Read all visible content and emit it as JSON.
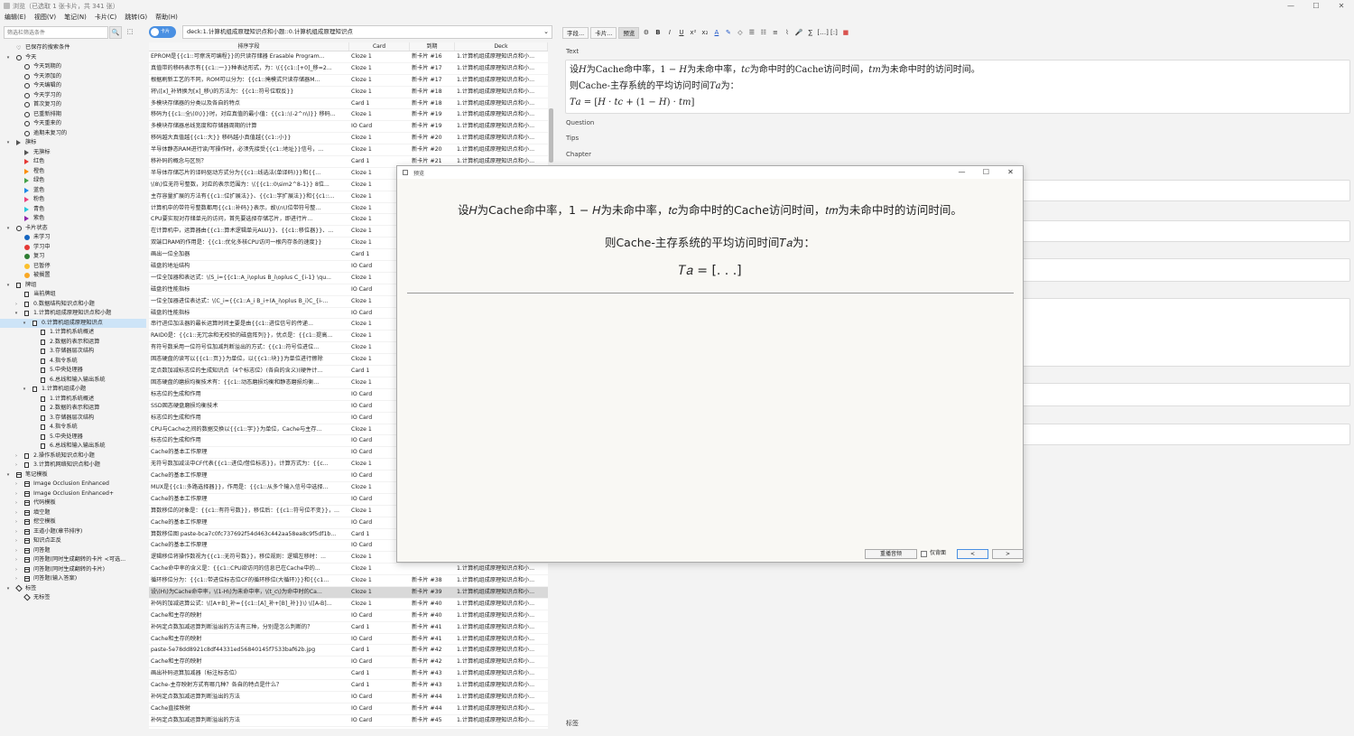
{
  "window": {
    "title": "浏览（已选取 1 张卡片，共 341 张）",
    "controls": [
      "—",
      "☐",
      "✕"
    ]
  },
  "menu": [
    "编辑(E)",
    "视图(V)",
    "笔记(N)",
    "卡片(C)",
    "跳转(G)",
    "帮助(H)"
  ],
  "sidebar": {
    "search_placeholder": "筛选栏筛选条件",
    "search_btn": "🔍",
    "toggle_btn": "⬚",
    "items": [
      {
        "label": "已保存的搜索条件",
        "level": 0,
        "icon": "heart",
        "arrow": ""
      },
      {
        "label": "今天",
        "level": 0,
        "icon": "clock",
        "arrow": "▾"
      },
      {
        "label": "今天到期的",
        "level": 1,
        "icon": "clock",
        "arrow": ""
      },
      {
        "label": "今天添加的",
        "level": 1,
        "icon": "clock",
        "arrow": ""
      },
      {
        "label": "今天编辑的",
        "level": 1,
        "icon": "clock",
        "arrow": ""
      },
      {
        "label": "今天学习的",
        "level": 1,
        "icon": "clock",
        "arrow": ""
      },
      {
        "label": "首次复习的",
        "level": 1,
        "icon": "clock",
        "arrow": ""
      },
      {
        "label": "已重新排期",
        "level": 1,
        "icon": "clock",
        "arrow": ""
      },
      {
        "label": "今天重来的",
        "level": 1,
        "icon": "clock",
        "arrow": ""
      },
      {
        "label": "逾期未复习的",
        "level": 1,
        "icon": "clock",
        "arrow": ""
      },
      {
        "label": "旗标",
        "level": 0,
        "icon": "flag",
        "arrow": "▾"
      },
      {
        "label": "无旗标",
        "level": 1,
        "icon": "flag",
        "arrow": ""
      },
      {
        "label": "红色",
        "level": 1,
        "icon": "flag",
        "arrow": "",
        "color": "#e53935"
      },
      {
        "label": "橙色",
        "level": 1,
        "icon": "flag",
        "arrow": "",
        "color": "#fb8c00"
      },
      {
        "label": "绿色",
        "level": 1,
        "icon": "flag",
        "arrow": "",
        "color": "#43a047"
      },
      {
        "label": "蓝色",
        "level": 1,
        "icon": "flag",
        "arrow": "",
        "color": "#1e88e5"
      },
      {
        "label": "粉色",
        "level": 1,
        "icon": "flag",
        "arrow": "",
        "color": "#ec407a"
      },
      {
        "label": "青色",
        "level": 1,
        "icon": "flag",
        "arrow": "",
        "color": "#26c6da"
      },
      {
        "label": "紫色",
        "level": 1,
        "icon": "flag",
        "arrow": "",
        "color": "#8e24aa"
      },
      {
        "label": "卡片状态",
        "level": 0,
        "icon": "circle",
        "arrow": "▾"
      },
      {
        "label": "未学习",
        "level": 1,
        "icon": "dot",
        "arrow": "",
        "color": "#1565c0"
      },
      {
        "label": "学习中",
        "level": 1,
        "icon": "dot",
        "arrow": "",
        "color": "#e53935"
      },
      {
        "label": "复习",
        "level": 1,
        "icon": "dot",
        "arrow": "",
        "color": "#2e7d32"
      },
      {
        "label": "已暂停",
        "level": 1,
        "icon": "dot",
        "arrow": "",
        "color": "#fbc02d"
      },
      {
        "label": "被搁置",
        "level": 1,
        "icon": "dot",
        "arrow": "",
        "color": "#f9a825"
      },
      {
        "label": "牌组",
        "level": 0,
        "icon": "deck",
        "arrow": "▾"
      },
      {
        "label": "当前牌组",
        "level": 1,
        "icon": "deck",
        "arrow": ""
      },
      {
        "label": "0.数据结构知识点和小题",
        "level": 1,
        "icon": "deck",
        "arrow": "›"
      },
      {
        "label": "1.计算机组成原理知识点和小题",
        "level": 1,
        "icon": "deck",
        "arrow": "▾"
      },
      {
        "label": "0.计算机组成原理知识点",
        "level": 2,
        "icon": "deck",
        "arrow": "▾",
        "selected": true
      },
      {
        "label": "1.计算机系统概述",
        "level": 3,
        "icon": "deck",
        "arrow": ""
      },
      {
        "label": "2.数据的表示和运算",
        "level": 3,
        "icon": "deck",
        "arrow": ""
      },
      {
        "label": "3.存储器层次结构",
        "level": 3,
        "icon": "deck",
        "arrow": ""
      },
      {
        "label": "4.指令系统",
        "level": 3,
        "icon": "deck",
        "arrow": ""
      },
      {
        "label": "5.中央处理器",
        "level": 3,
        "icon": "deck",
        "arrow": ""
      },
      {
        "label": "6.总线和输入输出系统",
        "level": 3,
        "icon": "deck",
        "arrow": ""
      },
      {
        "label": "1.计算机组成小题",
        "level": 2,
        "icon": "deck",
        "arrow": "▾"
      },
      {
        "label": "1.计算机系统概述",
        "level": 3,
        "icon": "deck",
        "arrow": ""
      },
      {
        "label": "2.数据的表示和运算",
        "level": 3,
        "icon": "deck",
        "arrow": ""
      },
      {
        "label": "3.存储器层次结构",
        "level": 3,
        "icon": "deck",
        "arrow": ""
      },
      {
        "label": "4.指令系统",
        "level": 3,
        "icon": "deck",
        "arrow": ""
      },
      {
        "label": "5.中央处理器",
        "level": 3,
        "icon": "deck",
        "arrow": ""
      },
      {
        "label": "6.总线和输入输出系统",
        "level": 3,
        "icon": "deck",
        "arrow": ""
      },
      {
        "label": "2.操作系统知识点和小题",
        "level": 1,
        "icon": "deck",
        "arrow": "›"
      },
      {
        "label": "3.计算机网络知识点和小题",
        "level": 1,
        "icon": "deck",
        "arrow": "›"
      },
      {
        "label": "笔记模板",
        "level": 0,
        "icon": "grid",
        "arrow": "▾"
      },
      {
        "label": "Image Occlusion Enhanced",
        "level": 1,
        "icon": "grid",
        "arrow": "›"
      },
      {
        "label": "Image Occlusion Enhanced+",
        "level": 1,
        "icon": "grid",
        "arrow": "›"
      },
      {
        "label": "代码模板",
        "level": 1,
        "icon": "grid",
        "arrow": "›"
      },
      {
        "label": "填空题",
        "level": 1,
        "icon": "grid",
        "arrow": "›"
      },
      {
        "label": "挖空模板",
        "level": 1,
        "icon": "grid",
        "arrow": "›"
      },
      {
        "label": "王道小题(章节排序)",
        "level": 1,
        "icon": "grid",
        "arrow": "›"
      },
      {
        "label": "知识点正反",
        "level": 1,
        "icon": "grid",
        "arrow": "›"
      },
      {
        "label": "问答题",
        "level": 1,
        "icon": "grid",
        "arrow": "›"
      },
      {
        "label": "问答题(同时生成翻转的卡片 <可选...",
        "level": 1,
        "icon": "grid",
        "arrow": "›"
      },
      {
        "label": "问答题(同时生成翻转的卡片)",
        "level": 1,
        "icon": "grid",
        "arrow": "›"
      },
      {
        "label": "问答题(输入答案)",
        "level": 1,
        "icon": "grid",
        "arrow": "›"
      },
      {
        "label": "标签",
        "level": 0,
        "icon": "tag",
        "arrow": "▾"
      },
      {
        "label": "无标签",
        "level": 1,
        "icon": "tag",
        "arrow": ""
      }
    ]
  },
  "toolbar": {
    "toggle_label": "卡片",
    "deck_query": "deck:1.计算机组成原理知识点和小题::0.计算机组成原理知识点"
  },
  "table": {
    "headers": [
      "排序字段",
      "Card",
      "到期",
      "Deck"
    ],
    "rows": [
      [
        "EPROM是{{c1::可擦洗可编程}}的只读存储器 Erasable Program...",
        "Cloze 1",
        "新卡片 #16",
        "1.计算机组成原理知识点和小..."
      ],
      [
        "真值带的移码表示有{{c1::一}}种表达形式，为：\\({{c1::[+0]_移=2...",
        "Cloze 1",
        "新卡片 #17",
        "1.计算机组成原理知识点和小..."
      ],
      [
        "根据刷新工艺的不同，ROM可以分为：{{c1::掩模式只读存储器M...",
        "Cloze 1",
        "新卡片 #17",
        "1.计算机组成原理知识点和小..."
      ],
      [
        "将\\([x]_补转换为[x]_移\\)的方法为：{{c1::符号位取反}}",
        "Cloze 1",
        "新卡片 #18",
        "1.计算机组成原理知识点和小..."
      ],
      [
        "多模块存储器的分类以及各自的特点",
        "Card 1",
        "新卡片 #18",
        "1.计算机组成原理知识点和小..."
      ],
      [
        "移码为{{c1::全\\(0\\)}}时，对应真值的最小值：{{c1::\\(-2^n\\)}} 移码...",
        "Cloze 1",
        "新卡片 #19",
        "1.计算机组成原理知识点和小..."
      ],
      [
        "多模块存储器总线宽度和存储器周期的计算",
        "IO Card",
        "新卡片 #19",
        "1.计算机组成原理知识点和小..."
      ],
      [
        "移码越大真值越{{c1::大}} 移码越小真值越{{c1::小}}",
        "Cloze 1",
        "新卡片 #20",
        "1.计算机组成原理知识点和小..."
      ],
      [
        "半导体静态RAM进行读/写操作时，必须先接受{{c1::地址}}信号，...",
        "Cloze 1",
        "新卡片 #20",
        "1.计算机组成原理知识点和小..."
      ],
      [
        "移补码的概念与区别？",
        "Card 1",
        "新卡片 #21",
        "1.计算机组成原理知识点和小..."
      ],
      [
        "半导体存储芯片的译码驱动方式分为{{c1::线选法(单译码)}}和{{...",
        "Cloze 1",
        "",
        "1.计算机组成原理知识点和小..."
      ],
      [
        "\\(8\\)位无符号整数，对应的表示范围为：\\({{c1::0\\sim2^8-1}} 8位...",
        "Cloze 1",
        "",
        "1.计算机组成原理知识点和小..."
      ],
      [
        "主存容量扩展的方法有{{c1::位扩展法}}、{{c1::字扩展法}}和{{c1::...",
        "Cloze 1",
        "",
        "1.计算机组成原理知识点和小..."
      ],
      [
        "计算机中的带符号整数都用{{c1::补码}}表示，故\\(n\\)位带符号整...",
        "Cloze 1",
        "",
        "1.计算机组成原理知识点和小..."
      ],
      [
        "CPU要实现对存储单元的访问，首先要选择存储芯片，即进行片...",
        "Cloze 1",
        "",
        "1.计算机组成原理知识点和小..."
      ],
      [
        "在计算机中，运算器由{{c1::算术逻辑单元ALU}}、{{c1::移位器}}、...",
        "Cloze 1",
        "",
        "1.计算机组成原理知识点和小..."
      ],
      [
        "双端口RAM的作用是：{{c1::优化多核CPU访问一根内存条的速度}}",
        "Cloze 1",
        "",
        "1.计算机组成原理知识点和小..."
      ],
      [
        "画出一位全加器",
        "Card 1",
        "",
        "1.计算机组成原理知识点和小..."
      ],
      [
        "磁盘的地址结构",
        "IO Card",
        "",
        "1.计算机组成原理知识点和小..."
      ],
      [
        "一位全加器和表达式：\\(S_i={{c1::A_i\\oplus B_i\\oplus C_{i-1} \\qu...",
        "Cloze 1",
        "",
        "1.计算机组成原理知识点和小..."
      ],
      [
        "磁盘的性能指标",
        "IO Card",
        "",
        "1.计算机组成原理知识点和小..."
      ],
      [
        "一位全加器进位表达式：\\(C_i={{c1::A_i B_i+(A_i\\oplus B_i)C_{i-...",
        "Cloze 1",
        "",
        "1.计算机组成原理知识点和小..."
      ],
      [
        "磁盘的性能指标",
        "IO Card",
        "",
        "1.计算机组成原理知识点和小..."
      ],
      [
        "串行进位加法器的最长运算时间主要是由{{c1::进位信号的传递...",
        "Cloze 1",
        "",
        "1.计算机组成原理知识点和小..."
      ],
      [
        "RAID0是：{{c1::无冗余和无校验的磁盘阵列}}，优点是：{{c1::提高...",
        "Cloze 1",
        "",
        "1.计算机组成原理知识点和小..."
      ],
      [
        "有符号数采用一位符号位加减判断溢出的方式：{{c1::符号位进位...",
        "Cloze 1",
        "",
        "1.计算机组成原理知识点和小..."
      ],
      [
        "固态硬盘的读写以{{c1::页}}为单位，以{{c1::块}}为单位进行擦除",
        "Cloze 1",
        "",
        "1.计算机组成原理知识点和小..."
      ],
      [
        "定点数加减标志位的生成知识点（4个标志位）(各自的含义)(硬件计...",
        "Card 1",
        "",
        "1.计算机组成原理知识点和小..."
      ],
      [
        "固态硬盘的磨损均衡技术有：{{c1::动态磨损均衡和静态磨损均衡...",
        "Cloze 1",
        "",
        "1.计算机组成原理知识点和小..."
      ],
      [
        "标志位的生成和作用",
        "IO Card",
        "",
        "1.计算机组成原理知识点和小..."
      ],
      [
        "SSD固态硬盘磨损均衡技术",
        "IO Card",
        "",
        "1.计算机组成原理知识点和小..."
      ],
      [
        "标志位的生成和作用",
        "IO Card",
        "",
        "1.计算机组成原理知识点和小..."
      ],
      [
        "CPU与Cache之间的数据交换以{{c1::字}}为单位，Cache与主存...",
        "Cloze 1",
        "",
        "1.计算机组成原理知识点和小..."
      ],
      [
        "标志位的生成和作用",
        "IO Card",
        "",
        "1.计算机组成原理知识点和小..."
      ],
      [
        "Cache的基本工作原理",
        "IO Card",
        "",
        "1.计算机组成原理知识点和小..."
      ],
      [
        "无符号数加减法中CF代表{{c1::进位/借位标志}}，计算方式为：{{c...",
        "Cloze 1",
        "",
        "1.计算机组成原理知识点和小..."
      ],
      [
        "Cache的基本工作原理",
        "IO Card",
        "",
        "1.计算机组成原理知识点和小..."
      ],
      [
        "MUX是{{c1::多路选择器}}，作用是：{{c1::从多个输入信号中选择...",
        "Cloze 1",
        "",
        "1.计算机组成原理知识点和小..."
      ],
      [
        "Cache的基本工作原理",
        "IO Card",
        "",
        "1.计算机组成原理知识点和小..."
      ],
      [
        "算数移位的对象是：{{c1::有符号数}}，移位后：{{c1::符号位不变}}，...",
        "Cloze 1",
        "",
        "1.计算机组成原理知识点和小..."
      ],
      [
        "Cache的基本工作原理",
        "IO Card",
        "",
        "1.计算机组成原理知识点和小..."
      ],
      [
        "算数移位图 paste-bca7c0fc737692f54d463c442aa58ea8c9f5df1b...",
        "Card 1",
        "",
        "1.计算机组成原理知识点和小..."
      ],
      [
        "Cache的基本工作原理",
        "IO Card",
        "",
        "1.计算机组成原理知识点和小..."
      ],
      [
        "逻辑移位将操作数视为{{c1::无符号数}}，移位规则：逻辑左移时：...",
        "Cloze 1",
        "",
        "1.计算机组成原理知识点和小..."
      ],
      [
        "Cache命中率的含义是：{{c1::CPU欲访问的信息已在Cache中的...",
        "Cloze 1",
        "",
        "1.计算机组成原理知识点和小..."
      ],
      [
        "循环移位分为：{{c1::带进位标志位CF的循环移位(大循环)}}和{{c1...",
        "Cloze 1",
        "新卡片 #38",
        "1.计算机组成原理知识点和小..."
      ],
      [
        "设\\(H\\)为Cache命中率，\\(1-H\\)为未命中率，\\(t_c\\)为命中时的Ca...",
        "Cloze 1",
        "新卡片 #39",
        "1.计算机组成原理知识点和小..."
      ],
      [
        "补码的加减运算公式：\\([A+B]_补={{c1::[A]_补+[B]_补}}\\) \\([A-B]...",
        "Cloze 1",
        "新卡片 #40",
        "1.计算机组成原理知识点和小..."
      ],
      [
        "Cache和主存的映射",
        "IO Card",
        "新卡片 #40",
        "1.计算机组成原理知识点和小..."
      ],
      [
        "补码定点数加减运算判断溢出的方法有三种，分别是怎么判断的？",
        "Card 1",
        "新卡片 #41",
        "1.计算机组成原理知识点和小..."
      ],
      [
        "Cache和主存的映射",
        "IO Card",
        "新卡片 #41",
        "1.计算机组成原理知识点和小..."
      ],
      [
        "paste-5e78dd8921c8df44331ed56840145f7533baf62b.jpg",
        "Card 1",
        "新卡片 #42",
        "1.计算机组成原理知识点和小..."
      ],
      [
        "Cache和主存的映射",
        "IO Card",
        "新卡片 #42",
        "1.计算机组成原理知识点和小..."
      ],
      [
        "画出补码运算加减器（标注标志位）",
        "Card 1",
        "新卡片 #43",
        "1.计算机组成原理知识点和小..."
      ],
      [
        "Cache-主存映射方式有哪几种？各自的特点是什么？",
        "Card 1",
        "新卡片 #43",
        "1.计算机组成原理知识点和小..."
      ],
      [
        "补码定点数加减运算判断溢出的方法",
        "IO Card",
        "新卡片 #44",
        "1.计算机组成原理知识点和小..."
      ],
      [
        "Cache直接映射",
        "IO Card",
        "新卡片 #44",
        "1.计算机组成原理知识点和小..."
      ],
      [
        "补码定点数加减运算判断溢出的方法",
        "IO Card",
        "新卡片 #45",
        "1.计算机组成原理知识点和小..."
      ]
    ],
    "selected_row": 46
  },
  "editor": {
    "tabs": [
      "字段...",
      "卡片...",
      "预览"
    ],
    "tools": [
      "B",
      "I",
      "U",
      "x²",
      "x₂",
      "A",
      "✎",
      "◇",
      "☰",
      "☷",
      "≡",
      "⌇",
      "🎤",
      "∑",
      "[…]",
      "[:]",
      "■"
    ],
    "fields": {
      "text_label": "Text",
      "question_label": "Question",
      "tips_label": "Tips",
      "chapter_label": "Chapter",
      "tags_label": "标签"
    },
    "text_line1": "设𝐻为Cache命中率，1 − 𝐻为未命中率，𝑡𝑐为命中时的Cache访问时间，𝑡𝑚为未命中时的访问时间。",
    "text_line2": "则Cache-主存系统的平均访问时间𝑇𝑎为：",
    "text_line3": "𝑇𝑎 = [𝐻 · 𝑡𝑐 + (1 − 𝐻) · 𝑡𝑚]"
  },
  "preview": {
    "title": "预览",
    "line1": "设𝐻为Cache命中率，1 − 𝐻为未命中率，𝑡𝑐为命中时的Cache访问时间，𝑡𝑚为未命中时的访问时间。",
    "line2": "则Cache-主存系统的平均访问时间𝑇𝑎为：",
    "line3": "𝑇𝑎 = [. . .]",
    "replay_label": "重播音频",
    "front_only_label": "仅背面",
    "prev_label": "<",
    "next_label": ">"
  }
}
